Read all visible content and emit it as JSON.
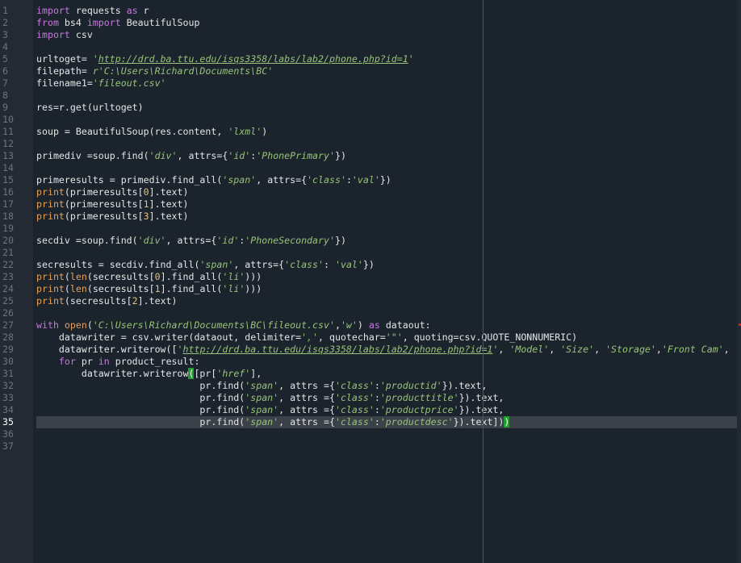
{
  "editor": {
    "active_line": 35,
    "ruler_column": 80,
    "colors": {
      "background": "#1b232d",
      "gutter": "#232a34",
      "keyword": "#c678dd",
      "builtin": "#e5a05a",
      "string": "#98c379",
      "number": "#e5c07b",
      "bracket_match": "#1f9d2f",
      "current_line": "#3a4149"
    },
    "line_numbers": [
      "1",
      "2",
      "3",
      "4",
      "5",
      "6",
      "7",
      "8",
      "9",
      "10",
      "11",
      "12",
      "13",
      "14",
      "15",
      "16",
      "17",
      "18",
      "19",
      "20",
      "21",
      "22",
      "23",
      "24",
      "25",
      "26",
      "27",
      "28",
      "29",
      "30",
      "31",
      "32",
      "33",
      "34",
      "35",
      "36",
      "37"
    ],
    "lines": [
      [
        {
          "t": "import",
          "c": "kw"
        },
        {
          "t": " requests "
        },
        {
          "t": "as",
          "c": "kw"
        },
        {
          "t": " r"
        }
      ],
      [
        {
          "t": "from",
          "c": "kw"
        },
        {
          "t": " bs4 "
        },
        {
          "t": "import",
          "c": "kw"
        },
        {
          "t": " BeautifulSoup"
        }
      ],
      [
        {
          "t": "import",
          "c": "kw"
        },
        {
          "t": " csv"
        }
      ],
      [],
      [
        {
          "t": "urltoget= "
        },
        {
          "t": "'",
          "c": "str"
        },
        {
          "t": "http://drd.ba.ttu.edu/isqs3358/labs/lab2/phone.php?id=1",
          "c": "url"
        },
        {
          "t": "'",
          "c": "str"
        }
      ],
      [
        {
          "t": "filepath= "
        },
        {
          "t": "r'C:\\Users\\Richard\\Documents\\BC'",
          "c": "str"
        }
      ],
      [
        {
          "t": "filename1="
        },
        {
          "t": "'fileout.csv'",
          "c": "str"
        }
      ],
      [],
      [
        {
          "t": "res=r.get(urltoget)"
        }
      ],
      [],
      [
        {
          "t": "soup = BeautifulSoup(res.content, "
        },
        {
          "t": "'lxml'",
          "c": "str"
        },
        {
          "t": ")"
        }
      ],
      [],
      [
        {
          "t": "primediv =soup.find("
        },
        {
          "t": "'div'",
          "c": "str"
        },
        {
          "t": ", attrs={"
        },
        {
          "t": "'id'",
          "c": "str"
        },
        {
          "t": ":"
        },
        {
          "t": "'PhonePrimary'",
          "c": "str"
        },
        {
          "t": "})"
        }
      ],
      [],
      [
        {
          "t": "primeresults = primediv.find_all("
        },
        {
          "t": "'span'",
          "c": "str"
        },
        {
          "t": ", attrs={"
        },
        {
          "t": "'class'",
          "c": "str"
        },
        {
          "t": ":"
        },
        {
          "t": "'val'",
          "c": "str"
        },
        {
          "t": "})"
        }
      ],
      [
        {
          "t": "print",
          "c": "fn"
        },
        {
          "t": "(primeresults["
        },
        {
          "t": "0",
          "c": "num"
        },
        {
          "t": "].text)"
        }
      ],
      [
        {
          "t": "print",
          "c": "fn"
        },
        {
          "t": "(primeresults["
        },
        {
          "t": "1",
          "c": "num"
        },
        {
          "t": "].text)"
        }
      ],
      [
        {
          "t": "print",
          "c": "fn"
        },
        {
          "t": "(primeresults["
        },
        {
          "t": "3",
          "c": "num"
        },
        {
          "t": "].text)"
        }
      ],
      [],
      [
        {
          "t": "secdiv =soup.find("
        },
        {
          "t": "'div'",
          "c": "str"
        },
        {
          "t": ", attrs={"
        },
        {
          "t": "'id'",
          "c": "str"
        },
        {
          "t": ":"
        },
        {
          "t": "'PhoneSecondary'",
          "c": "str"
        },
        {
          "t": "})"
        }
      ],
      [],
      [
        {
          "t": "secresults = secdiv.find_all("
        },
        {
          "t": "'span'",
          "c": "str"
        },
        {
          "t": ", attrs={"
        },
        {
          "t": "'class'",
          "c": "str"
        },
        {
          "t": ": "
        },
        {
          "t": "'val'",
          "c": "str"
        },
        {
          "t": "})"
        }
      ],
      [
        {
          "t": "print",
          "c": "fn"
        },
        {
          "t": "("
        },
        {
          "t": "len",
          "c": "fn"
        },
        {
          "t": "(secresults["
        },
        {
          "t": "0",
          "c": "num"
        },
        {
          "t": "].find_all("
        },
        {
          "t": "'li'",
          "c": "str"
        },
        {
          "t": ")))"
        }
      ],
      [
        {
          "t": "print",
          "c": "fn"
        },
        {
          "t": "("
        },
        {
          "t": "len",
          "c": "fn"
        },
        {
          "t": "(secresults["
        },
        {
          "t": "1",
          "c": "num"
        },
        {
          "t": "].find_all("
        },
        {
          "t": "'li'",
          "c": "str"
        },
        {
          "t": ")))"
        }
      ],
      [
        {
          "t": "print",
          "c": "fn"
        },
        {
          "t": "(secresults["
        },
        {
          "t": "2",
          "c": "num"
        },
        {
          "t": "].text)"
        }
      ],
      [],
      [
        {
          "t": "with",
          "c": "kw"
        },
        {
          "t": " "
        },
        {
          "t": "open",
          "c": "fn"
        },
        {
          "t": "("
        },
        {
          "t": "'C:\\Users\\Richard\\Documents\\BC\\fileout.csv'",
          "c": "str"
        },
        {
          "t": ","
        },
        {
          "t": "'w'",
          "c": "str"
        },
        {
          "t": ") "
        },
        {
          "t": "as",
          "c": "kw"
        },
        {
          "t": " dataout:"
        }
      ],
      [
        {
          "t": "    datawriter = csv.writer(dataout, delimiter="
        },
        {
          "t": "','",
          "c": "str"
        },
        {
          "t": ", quotechar="
        },
        {
          "t": "'\"'",
          "c": "str"
        },
        {
          "t": ", quoting=csv.QUOTE_NONNUMERIC)"
        }
      ],
      [
        {
          "t": "    datawriter.writerow(["
        },
        {
          "t": "'",
          "c": "str"
        },
        {
          "t": "http://drd.ba.ttu.edu/isqs3358/labs/lab2/phone.php?id=1",
          "c": "url"
        },
        {
          "t": "'",
          "c": "str"
        },
        {
          "t": ", "
        },
        {
          "t": "'Model'",
          "c": "str"
        },
        {
          "t": ", "
        },
        {
          "t": "'Size'",
          "c": "str"
        },
        {
          "t": ", "
        },
        {
          "t": "'Storage'",
          "c": "str"
        },
        {
          "t": ","
        },
        {
          "t": "'Front Cam'",
          "c": "str"
        },
        {
          "t": ","
        }
      ],
      [
        {
          "t": "    "
        },
        {
          "t": "for",
          "c": "kw"
        },
        {
          "t": " pr "
        },
        {
          "t": "in",
          "c": "kw"
        },
        {
          "t": " product_result:"
        }
      ],
      [
        {
          "t": "        datawriter.writerow"
        },
        {
          "t": "(",
          "c": "bm"
        },
        {
          "t": "[pr["
        },
        {
          "t": "'href'",
          "c": "str"
        },
        {
          "t": "],"
        }
      ],
      [
        {
          "t": "                             pr.find("
        },
        {
          "t": "'span'",
          "c": "str"
        },
        {
          "t": ", attrs ={"
        },
        {
          "t": "'class'",
          "c": "str"
        },
        {
          "t": ":"
        },
        {
          "t": "'productid'",
          "c": "str"
        },
        {
          "t": "}).text,"
        }
      ],
      [
        {
          "t": "                             pr.find("
        },
        {
          "t": "'span'",
          "c": "str"
        },
        {
          "t": ", attrs ={"
        },
        {
          "t": "'class'",
          "c": "str"
        },
        {
          "t": ":"
        },
        {
          "t": "'producttitle'",
          "c": "str"
        },
        {
          "t": "}).text,"
        }
      ],
      [
        {
          "t": "                             pr.find("
        },
        {
          "t": "'span'",
          "c": "str"
        },
        {
          "t": ", attrs ={"
        },
        {
          "t": "'class'",
          "c": "str"
        },
        {
          "t": ":"
        },
        {
          "t": "'productprice'",
          "c": "str"
        },
        {
          "t": "}).text,"
        }
      ],
      [
        {
          "t": "                             pr.find("
        },
        {
          "t": "'span'",
          "c": "str"
        },
        {
          "t": ", attrs ={"
        },
        {
          "t": "'class'",
          "c": "str"
        },
        {
          "t": ":"
        },
        {
          "t": "'productdesc'",
          "c": "str"
        },
        {
          "t": "}).text])"
        },
        {
          "t": ")",
          "c": "bm"
        }
      ],
      [],
      []
    ]
  }
}
